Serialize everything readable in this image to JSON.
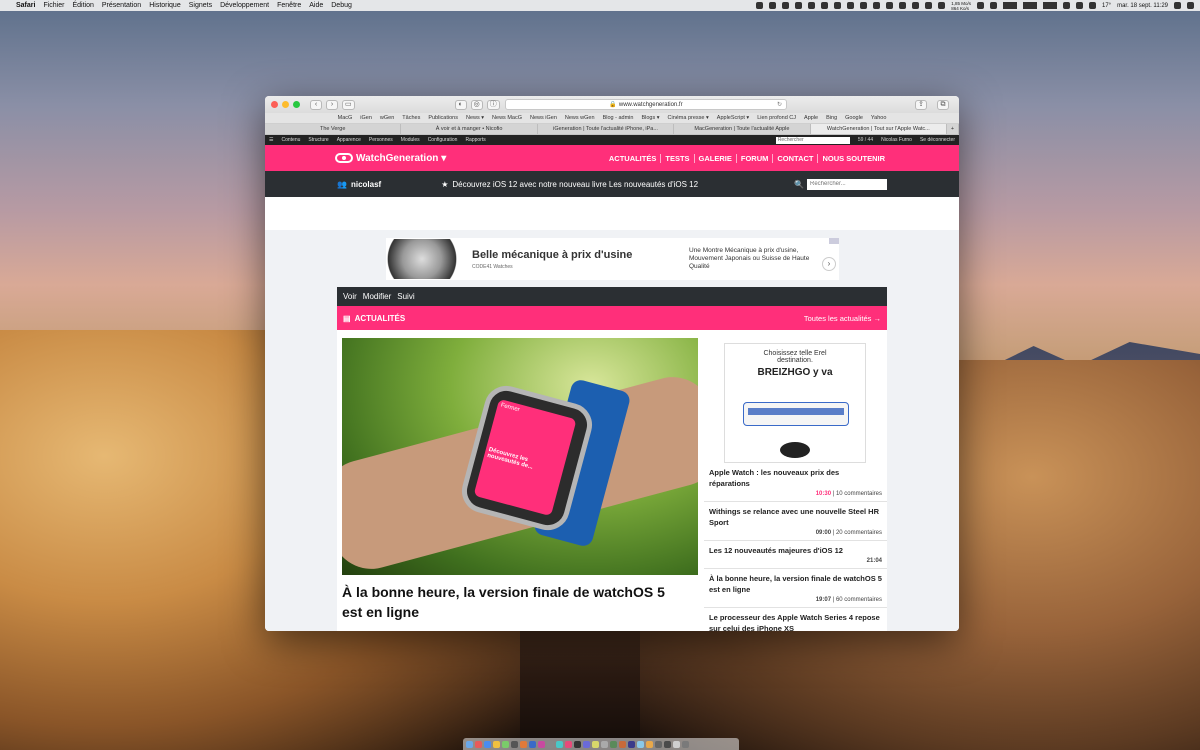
{
  "menubar": {
    "app": "Safari",
    "items": [
      "Fichier",
      "Édition",
      "Présentation",
      "Historique",
      "Signets",
      "Développement",
      "Fenêtre",
      "Aide",
      "Debug"
    ],
    "net_up": "1,85 Mo/s",
    "net_down": "864 Ko/s",
    "temp": "17°",
    "clock": "mar. 18 sept. 11:29"
  },
  "browser": {
    "url": "www.watchgeneration.fr",
    "bookmarks": [
      "MacG",
      "iGen",
      "wGen",
      "Tâches",
      "Publications",
      "News ▾",
      "News MacG",
      "News iGen",
      "News wGen",
      "Blog - admin",
      "Blogs ▾",
      "Cinéma presse ▾",
      "AppleScript ▾",
      "Lien profond CJ",
      "Apple",
      "Bing",
      "Google",
      "Yahoo"
    ],
    "tabs": [
      "The Verge",
      "À voir et à manger • Nicofio",
      "iGeneration | Toute l'actualité iPhone, iPa...",
      "MacGeneration | Toute l'actualité Apple",
      "WatchGeneration | Tout sur l'Apple Watc..."
    ],
    "new_tab": "+"
  },
  "admin": {
    "items": [
      "Contenu",
      "Structure",
      "Apparence",
      "Personnes",
      "Modules",
      "Configuration",
      "Rapports"
    ],
    "search_placeholder": "Rechercher",
    "count": "59 / 44",
    "user": "Nicolas Furno",
    "logout": "Se déconnecter"
  },
  "site": {
    "logo": "WatchGeneration ▾",
    "nav": [
      "ACTUALITÉS",
      "TESTS",
      "GALERIE",
      "FORUM",
      "CONTACT",
      "NOUS SOUTENIR"
    ],
    "user": "nicolasf",
    "promo": "Découvrez iOS 12 avec notre nouveau livre Les nouveautés d'iOS 12",
    "search_placeholder": "Rechercher..."
  },
  "ad_top": {
    "title": "Belle mécanique à prix d'usine",
    "brand": "CODE41 Watches",
    "desc": "Une Montre Mécanique à prix d'usine, Mouvement Japonais ou Suisse de Haute Qualité"
  },
  "editbar": [
    "Voir",
    "Modifier",
    "Suivi"
  ],
  "section": {
    "title": "ACTUALITÉS",
    "link": "Toutes les actualités →"
  },
  "hero": {
    "title": "À la bonne heure, la version finale de wat­chOS 5 est en ligne",
    "screen_top": "Fermer",
    "screen_text": "Découvrez les nouveautés de..."
  },
  "side_ad": {
    "line1": "Choisissez telle Erel",
    "line2": "destination.",
    "line3": "BREIZHGO y va"
  },
  "sidebar_articles": [
    {
      "title": "Apple Watch : les nouveaux prix des réparations",
      "time": "10:30",
      "comments": " | 10 commentaires",
      "hot": true
    },
    {
      "title": "Withings se relance avec une nouvelle Steel HR Sport",
      "time": "09:00",
      "comments": " | 20 commentaires",
      "hot": false
    },
    {
      "title": "Les 12 nouveautés majeures d'iOS 12",
      "time": "21:04",
      "comments": "",
      "hot": false
    },
    {
      "title": "À la bonne heure, la version finale de watchOS 5 est en ligne",
      "time": "19:07",
      "comments": " | 60 commentaires",
      "hot": false
    },
    {
      "title": "Le processeur des Apple Watch Series 4 repose sur celui des iPhone XS",
      "time": "",
      "comments": "",
      "hot": false
    }
  ],
  "colors": {
    "brand": "#ff2f7a",
    "dark_bar": "#2b2f33"
  }
}
